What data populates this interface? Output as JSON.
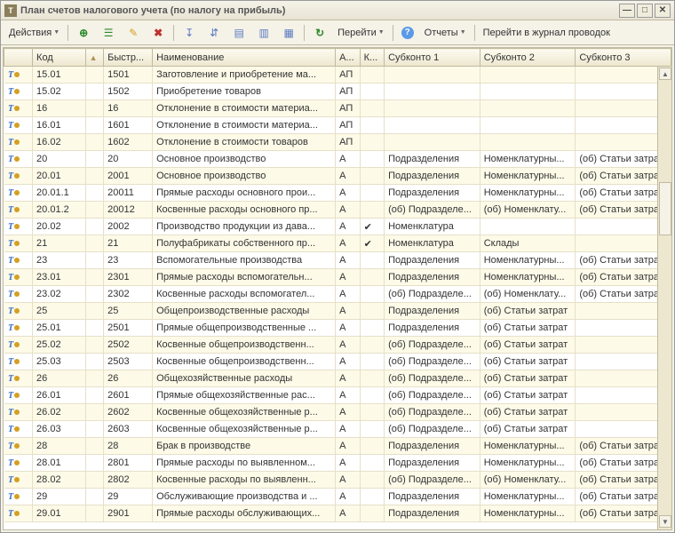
{
  "window": {
    "title": "План счетов налогового учета (по налогу на прибыль)"
  },
  "toolbar": {
    "actions": "Действия",
    "goto": "Перейти",
    "reports": "Отчеты",
    "journal": "Перейти в журнал проводок"
  },
  "columns": {
    "code": "Код",
    "fast": "Быстр...",
    "name": "Наименование",
    "a": "А...",
    "k": "К...",
    "sub1": "Субконто 1",
    "sub2": "Субконто 2",
    "sub3": "Субконто 3"
  },
  "rows": [
    {
      "code": "15.01",
      "fast": "1501",
      "name": "Заготовление и приобретение ма...",
      "a": "АП",
      "k": "",
      "s1": "",
      "s2": "",
      "s3": "",
      "alt": true
    },
    {
      "code": "15.02",
      "fast": "1502",
      "name": "Приобретение товаров",
      "a": "АП",
      "k": "",
      "s1": "",
      "s2": "",
      "s3": ""
    },
    {
      "code": "16",
      "fast": "16",
      "name": "Отклонение в стоимости материа...",
      "a": "АП",
      "k": "",
      "s1": "",
      "s2": "",
      "s3": "",
      "alt": true
    },
    {
      "code": "16.01",
      "fast": "1601",
      "name": "Отклонение в стоимости материа...",
      "a": "АП",
      "k": "",
      "s1": "",
      "s2": "",
      "s3": ""
    },
    {
      "code": "16.02",
      "fast": "1602",
      "name": "Отклонение в стоимости товаров",
      "a": "АП",
      "k": "",
      "s1": "",
      "s2": "",
      "s3": "",
      "alt": true
    },
    {
      "code": "20",
      "fast": "20",
      "name": "Основное производство",
      "a": "А",
      "k": "",
      "s1": "Подразделения",
      "s2": "Номенклатурны...",
      "s3": "(об) Статьи затрат"
    },
    {
      "code": "20.01",
      "fast": "2001",
      "name": "Основное производство",
      "a": "А",
      "k": "",
      "s1": "Подразделения",
      "s2": "Номенклатурны...",
      "s3": "(об) Статьи затрат",
      "alt": true
    },
    {
      "code": "20.01.1",
      "fast": "20011",
      "name": "Прямые расходы основного прои...",
      "a": "А",
      "k": "",
      "s1": "Подразделения",
      "s2": "Номенклатурны...",
      "s3": "(об) Статьи затрат"
    },
    {
      "code": "20.01.2",
      "fast": "20012",
      "name": "Косвенные расходы основного пр...",
      "a": "А",
      "k": "",
      "s1": "(об) Подразделе...",
      "s2": "(об) Номенклату...",
      "s3": "(об) Статьи затрат",
      "alt": true
    },
    {
      "code": "20.02",
      "fast": "2002",
      "name": "Производство продукции из дава...",
      "a": "А",
      "k": "✔",
      "s1": "Номенклатура",
      "s2": "",
      "s3": ""
    },
    {
      "code": "21",
      "fast": "21",
      "name": "Полуфабрикаты собственного пр...",
      "a": "А",
      "k": "✔",
      "s1": "Номенклатура",
      "s2": "Склады",
      "s3": "",
      "alt": true
    },
    {
      "code": "23",
      "fast": "23",
      "name": "Вспомогательные производства",
      "a": "А",
      "k": "",
      "s1": "Подразделения",
      "s2": "Номенклатурны...",
      "s3": "(об) Статьи затрат"
    },
    {
      "code": "23.01",
      "fast": "2301",
      "name": "Прямые расходы вспомогательн...",
      "a": "А",
      "k": "",
      "s1": "Подразделения",
      "s2": "Номенклатурны...",
      "s3": "(об) Статьи затрат",
      "alt": true
    },
    {
      "code": "23.02",
      "fast": "2302",
      "name": "Косвенные расходы вспомогател...",
      "a": "А",
      "k": "",
      "s1": "(об) Подразделе...",
      "s2": "(об) Номенклату...",
      "s3": "(об) Статьи затрат"
    },
    {
      "code": "25",
      "fast": "25",
      "name": "Общепроизводственные расходы",
      "a": "А",
      "k": "",
      "s1": "Подразделения",
      "s2": "(об) Статьи затрат",
      "s3": "",
      "alt": true
    },
    {
      "code": "25.01",
      "fast": "2501",
      "name": "Прямые общепроизводственные ...",
      "a": "А",
      "k": "",
      "s1": "Подразделения",
      "s2": "(об) Статьи затрат",
      "s3": ""
    },
    {
      "code": "25.02",
      "fast": "2502",
      "name": "Косвенные общепроизводственн...",
      "a": "А",
      "k": "",
      "s1": "(об) Подразделе...",
      "s2": "(об) Статьи затрат",
      "s3": "",
      "alt": true
    },
    {
      "code": "25.03",
      "fast": "2503",
      "name": "Косвенные общепроизводственн...",
      "a": "А",
      "k": "",
      "s1": "(об) Подразделе...",
      "s2": "(об) Статьи затрат",
      "s3": ""
    },
    {
      "code": "26",
      "fast": "26",
      "name": "Общехозяйственные расходы",
      "a": "А",
      "k": "",
      "s1": "(об) Подразделе...",
      "s2": "(об) Статьи затрат",
      "s3": "",
      "alt": true
    },
    {
      "code": "26.01",
      "fast": "2601",
      "name": "Прямые общехозяйственные рас...",
      "a": "А",
      "k": "",
      "s1": "(об) Подразделе...",
      "s2": "(об) Статьи затрат",
      "s3": ""
    },
    {
      "code": "26.02",
      "fast": "2602",
      "name": "Косвенные общехозяйственные р...",
      "a": "А",
      "k": "",
      "s1": "(об) Подразделе...",
      "s2": "(об) Статьи затрат",
      "s3": "",
      "alt": true
    },
    {
      "code": "26.03",
      "fast": "2603",
      "name": "Косвенные общехозяйственные р...",
      "a": "А",
      "k": "",
      "s1": "(об) Подразделе...",
      "s2": "(об) Статьи затрат",
      "s3": ""
    },
    {
      "code": "28",
      "fast": "28",
      "name": "Брак в производстве",
      "a": "А",
      "k": "",
      "s1": "Подразделения",
      "s2": "Номенклатурны...",
      "s3": "(об) Статьи затрат",
      "alt": true
    },
    {
      "code": "28.01",
      "fast": "2801",
      "name": "Прямые расходы по выявленном...",
      "a": "А",
      "k": "",
      "s1": "Подразделения",
      "s2": "Номенклатурны...",
      "s3": "(об) Статьи затрат"
    },
    {
      "code": "28.02",
      "fast": "2802",
      "name": "Косвенные расходы по выявленн...",
      "a": "А",
      "k": "",
      "s1": "(об) Подразделе...",
      "s2": "(об) Номенклату...",
      "s3": "(об) Статьи затрат",
      "alt": true
    },
    {
      "code": "29",
      "fast": "29",
      "name": "Обслуживающие производства и ...",
      "a": "А",
      "k": "",
      "s1": "Подразделения",
      "s2": "Номенклатурны...",
      "s3": "(об) Статьи затрат"
    },
    {
      "code": "29.01",
      "fast": "2901",
      "name": "Прямые расходы обслуживающих...",
      "a": "А",
      "k": "",
      "s1": "Подразделения",
      "s2": "Номенклатурны...",
      "s3": "(об) Статьи затрат",
      "alt": true
    }
  ]
}
